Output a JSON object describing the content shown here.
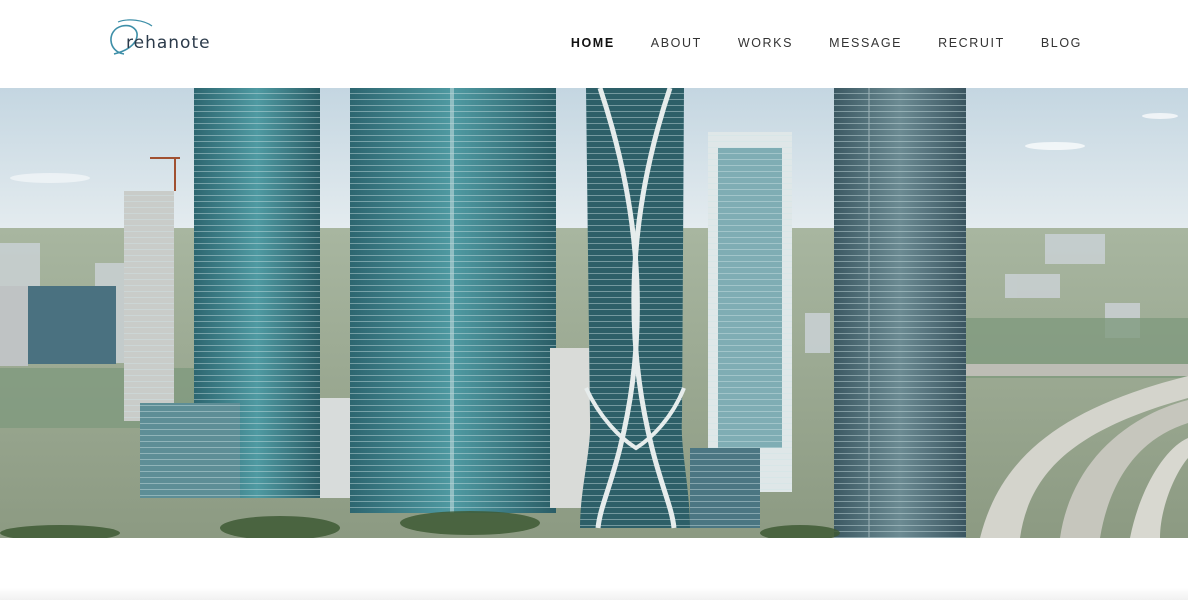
{
  "brand": {
    "logo_text": "rehanote",
    "accent_color": "#3e8fa8"
  },
  "nav": {
    "items": [
      {
        "label": "HOME",
        "active": true
      },
      {
        "label": "ABOUT",
        "active": false
      },
      {
        "label": "WORKS",
        "active": false
      },
      {
        "label": "MESSAGE",
        "active": false
      },
      {
        "label": "RECRUIT",
        "active": false
      },
      {
        "label": "BLOG",
        "active": false
      }
    ]
  },
  "hero": {
    "image_subject": "city-skyline-photo",
    "colors": {
      "sky": "#d6e3ea",
      "tower_glass": "#2f6f78",
      "tower_dark": "#3b5560",
      "highway": "#c9c9c2",
      "greenery": "#6f8f4f"
    }
  }
}
